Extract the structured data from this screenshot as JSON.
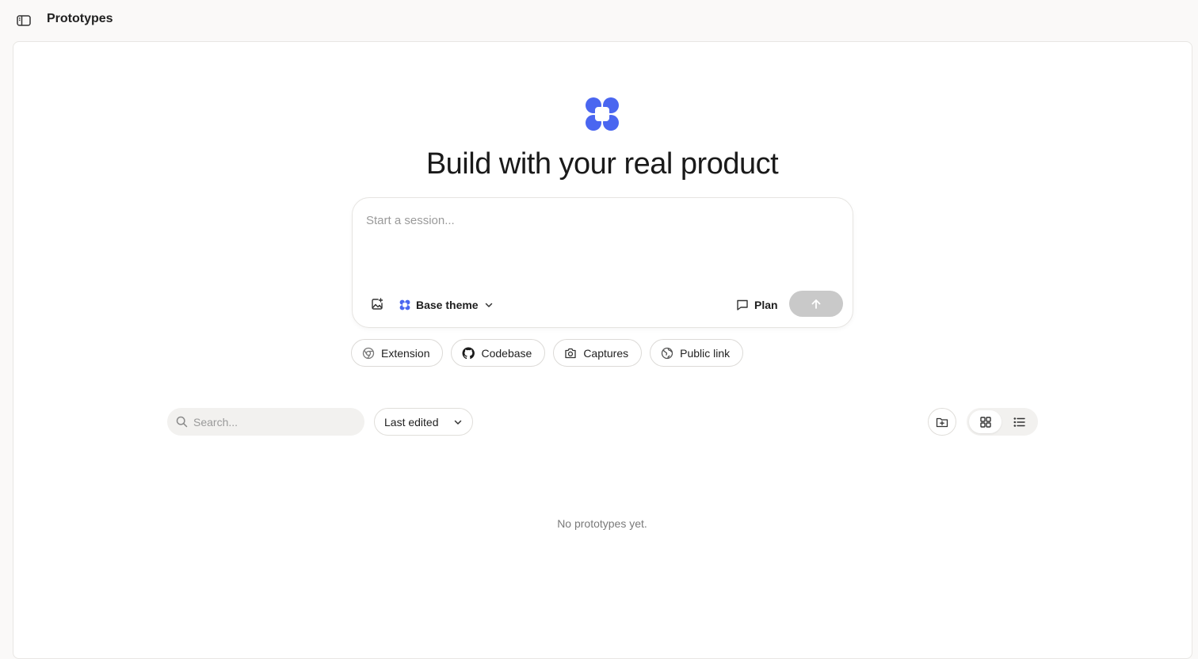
{
  "header": {
    "title": "Prototypes"
  },
  "hero": {
    "title": "Build with your real product"
  },
  "composer": {
    "placeholder": "Start a session...",
    "theme_label": "Base theme",
    "plan_label": "Plan"
  },
  "chips": [
    {
      "label": "Extension",
      "icon": "chrome-icon"
    },
    {
      "label": "Codebase",
      "icon": "github-icon"
    },
    {
      "label": "Captures",
      "icon": "camera-icon"
    },
    {
      "label": "Public link",
      "icon": "globe-icon"
    }
  ],
  "toolbar": {
    "search_placeholder": "Search...",
    "sort_value": "Last edited",
    "view_mode": "grid"
  },
  "empty_state": {
    "message": "No prototypes yet."
  },
  "colors": {
    "brand": "#4a66f0",
    "send_disabled": "#c9c9c9"
  }
}
